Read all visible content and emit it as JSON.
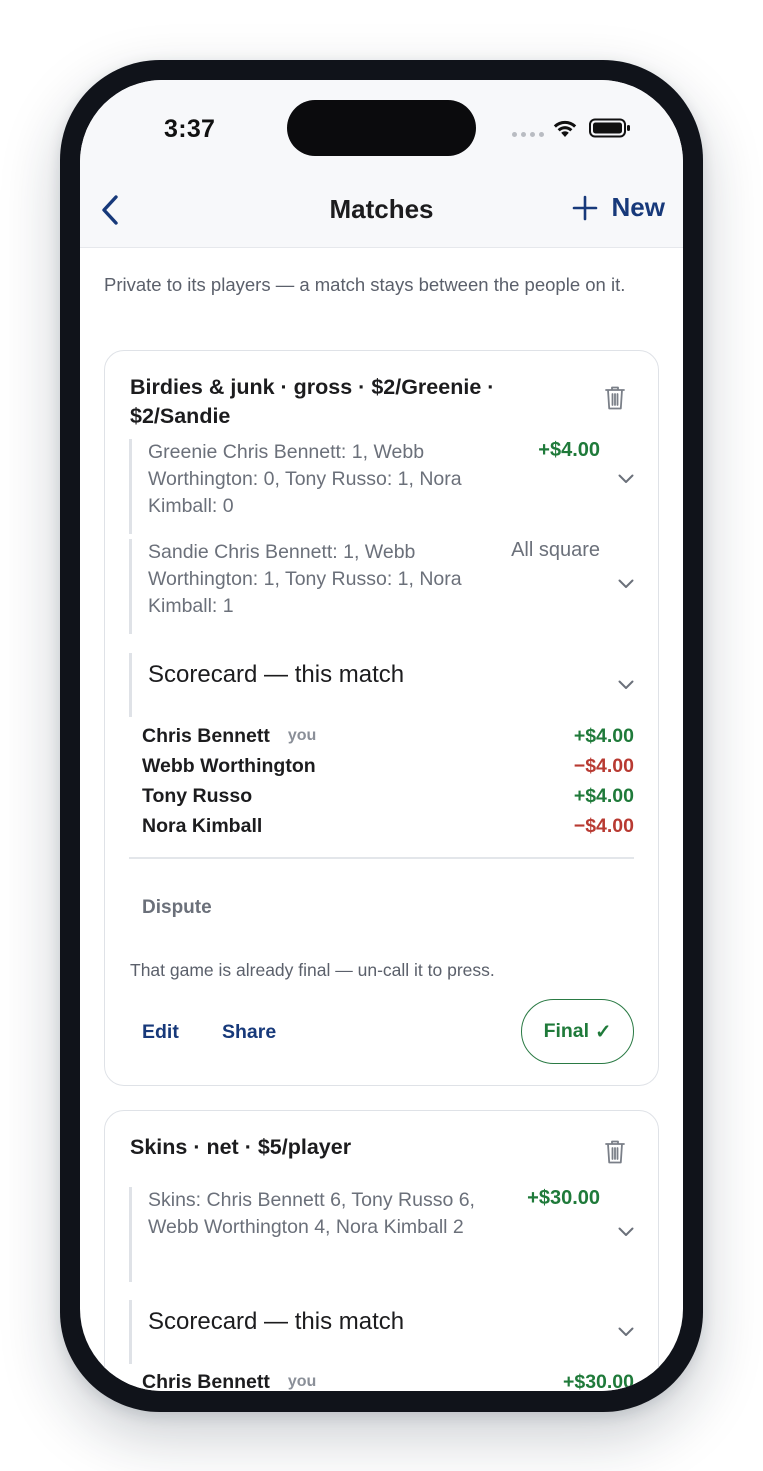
{
  "status_bar": {
    "time": "3:37"
  },
  "nav": {
    "title": "Matches",
    "new_label": "New"
  },
  "intro": "Private to its players — a match stays between the people on it.",
  "matches": [
    {
      "title": "Birdies & junk · gross · $2/Greenie · $2/Sandie",
      "lines": [
        {
          "text": "Greenie Chris Bennett: 1, Webb Worthington: 0, Tony Russo: 1, Nora Kimball: 0",
          "amount": "+$4.00"
        },
        {
          "text": "Sandie Chris Bennett: 1, Webb Worthington: 1, Tony Russo: 1, Nora Kimball: 1",
          "amount": "All square"
        }
      ],
      "scorecard_label": "Scorecard — this match",
      "players": [
        {
          "name": "Chris Bennett",
          "tag": "you",
          "amount": "+$4.00"
        },
        {
          "name": "Webb Worthington",
          "tag": "",
          "amount": "−$4.00"
        },
        {
          "name": "Tony Russo",
          "tag": "",
          "amount": "+$4.00"
        },
        {
          "name": "Nora Kimball",
          "tag": "",
          "amount": "−$4.00"
        }
      ],
      "dispute_label": "Dispute",
      "note": "That game is already final — un-call it to press.",
      "edit_label": "Edit",
      "share_label": "Share",
      "final_label": "Final",
      "final_mark": "✓"
    },
    {
      "title": "Skins · net · $5/player",
      "lines": [
        {
          "text": "Skins: Chris Bennett 6, Tony Russo 6, Webb Worthington 4, Nora Kimball 2",
          "amount": "+$30.00"
        }
      ],
      "scorecard_label": "Scorecard — this match",
      "players": [
        {
          "name": "Chris Bennett",
          "tag": "you",
          "amount": "+$30.00"
        }
      ]
    }
  ],
  "colors": {
    "accent": "#17397a",
    "positive": "#1f7a3a",
    "negative": "#b83a32",
    "muted": "#6b707a"
  }
}
